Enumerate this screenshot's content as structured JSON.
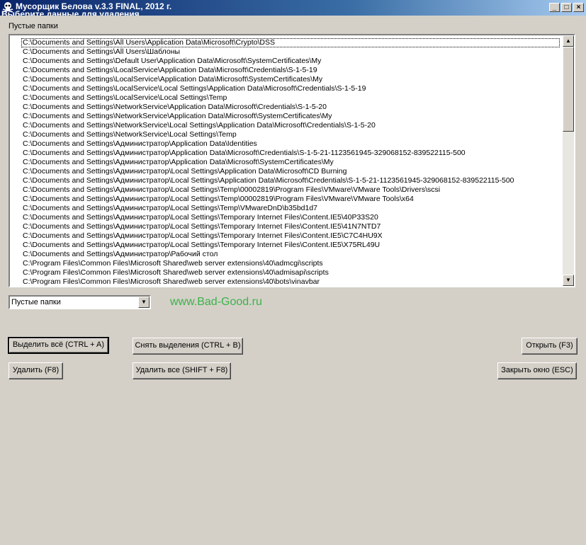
{
  "window": {
    "title": "Мусорщик Белова v.3.3 FINAL, 2012 г.",
    "subtitle": "Выберите данные для удаления.",
    "controls": {
      "minimize": "_",
      "maximize": "□",
      "close": "×"
    }
  },
  "group_label": "Пустые папки",
  "list": {
    "items": [
      "C:\\Documents and Settings\\All Users\\Application Data\\Microsoft\\Crypto\\DSS",
      "C:\\Documents and Settings\\All Users\\Шаблоны",
      "C:\\Documents and Settings\\Default User\\Application Data\\Microsoft\\SystemCertificates\\My",
      "C:\\Documents and Settings\\LocalService\\Application Data\\Microsoft\\Credentials\\S-1-5-19",
      "C:\\Documents and Settings\\LocalService\\Application Data\\Microsoft\\SystemCertificates\\My",
      "C:\\Documents and Settings\\LocalService\\Local Settings\\Application Data\\Microsoft\\Credentials\\S-1-5-19",
      "C:\\Documents and Settings\\LocalService\\Local Settings\\Temp",
      "C:\\Documents and Settings\\NetworkService\\Application Data\\Microsoft\\Credentials\\S-1-5-20",
      "C:\\Documents and Settings\\NetworkService\\Application Data\\Microsoft\\SystemCertificates\\My",
      "C:\\Documents and Settings\\NetworkService\\Local Settings\\Application Data\\Microsoft\\Credentials\\S-1-5-20",
      "C:\\Documents and Settings\\NetworkService\\Local Settings\\Temp",
      "C:\\Documents and Settings\\Администратор\\Application Data\\Identities",
      "C:\\Documents and Settings\\Администратор\\Application Data\\Microsoft\\Credentials\\S-1-5-21-1123561945-329068152-839522115-500",
      "C:\\Documents and Settings\\Администратор\\Application Data\\Microsoft\\SystemCertificates\\My",
      "C:\\Documents and Settings\\Администратор\\Local Settings\\Application Data\\Microsoft\\CD Burning",
      "C:\\Documents and Settings\\Администратор\\Local Settings\\Application Data\\Microsoft\\Credentials\\S-1-5-21-1123561945-329068152-839522115-500",
      "C:\\Documents and Settings\\Администратор\\Local Settings\\Temp\\00002819\\Program Files\\VMware\\VMware Tools\\Drivers\\scsi",
      "C:\\Documents and Settings\\Администратор\\Local Settings\\Temp\\00002819\\Program Files\\VMware\\VMware Tools\\x64",
      "C:\\Documents and Settings\\Администратор\\Local Settings\\Temp\\VMwareDnD\\b35bd1d7",
      "C:\\Documents and Settings\\Администратор\\Local Settings\\Temporary Internet Files\\Content.IE5\\40P33S20",
      "C:\\Documents and Settings\\Администратор\\Local Settings\\Temporary Internet Files\\Content.IE5\\41N7NTD7",
      "C:\\Documents and Settings\\Администратор\\Local Settings\\Temporary Internet Files\\Content.IE5\\C7C4HU9X",
      "C:\\Documents and Settings\\Администратор\\Local Settings\\Temporary Internet Files\\Content.IE5\\X75RL49U",
      "C:\\Documents and Settings\\Администратор\\Рабочий стол",
      "C:\\Program Files\\Common Files\\Microsoft Shared\\web server extensions\\40\\admcgi\\scripts",
      "C:\\Program Files\\Common Files\\Microsoft Shared\\web server extensions\\40\\admisapi\\scripts",
      "C:\\Program Files\\Common Files\\Microsoft Shared\\web server extensions\\40\\bots\\vinavbar"
    ]
  },
  "scrollbar": {
    "up": "▲",
    "down": "▼"
  },
  "combo": {
    "value": "Пустые папки",
    "arrow": "▼"
  },
  "site_link": "www.Bad-Good.ru",
  "buttons": {
    "select_all": "Выделить всё (CTRL + A)",
    "deselect": "Снять выделения (CTRL + B)",
    "open": "Открыть (F3)",
    "delete": "Удалить (F8)",
    "delete_all": "Удалить все (SHIFT + F8)",
    "close": "Закрыть окно (ESC)"
  }
}
